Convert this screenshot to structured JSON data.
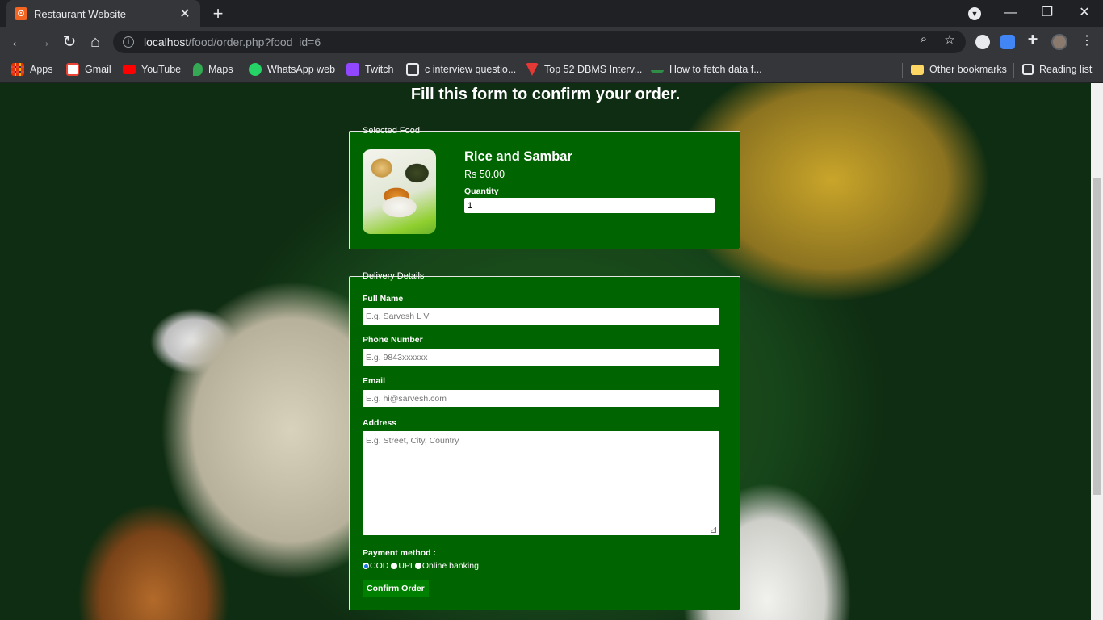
{
  "browser": {
    "tab_title": "Restaurant Website",
    "url_host": "localhost",
    "url_path": "/food/order.php?food_id=6",
    "bookmarks": [
      {
        "label": "Apps",
        "icon": "apps-grid-icon",
        "color": "#ea4335"
      },
      {
        "label": "Gmail",
        "icon": "gmail-icon",
        "color": "#ea4335"
      },
      {
        "label": "YouTube",
        "icon": "youtube-icon",
        "color": "#ff0000"
      },
      {
        "label": "Maps",
        "icon": "maps-icon",
        "color": "#34a853"
      },
      {
        "label": "WhatsApp web",
        "icon": "whatsapp-icon",
        "color": "#25d366"
      },
      {
        "label": "Twitch",
        "icon": "twitch-icon",
        "color": "#9146ff"
      },
      {
        "label": "c interview questio...",
        "icon": "page-icon",
        "color": "#e8eaed"
      },
      {
        "label": "Top 52 DBMS Interv...",
        "icon": "guru-icon",
        "color": "#e53935"
      },
      {
        "label": "How to fetch data f...",
        "icon": "geeks-icon",
        "color": "#2f8d46"
      }
    ],
    "other_bookmarks": "Other bookmarks",
    "reading_list": "Reading list"
  },
  "page": {
    "heading": "Fill this form to confirm your order.",
    "selected_food": {
      "legend": "Selected Food",
      "name": "Rice and Sambar",
      "price": "Rs 50.00",
      "quantity_label": "Quantity",
      "quantity_value": "1"
    },
    "delivery": {
      "legend": "Delivery Details",
      "full_name_label": "Full Name",
      "full_name_placeholder": "E.g. Sarvesh L V",
      "phone_label": "Phone Number",
      "phone_placeholder": "E.g. 9843xxxxxx",
      "email_label": "Email",
      "email_placeholder": "E.g. hi@sarvesh.com",
      "address_label": "Address",
      "address_placeholder": "E.g. Street, City, Country",
      "payment_label": "Payment method :",
      "payment_options": [
        "COD",
        "UPI",
        "Online banking"
      ],
      "payment_selected": "COD",
      "confirm_label": "Confirm Order"
    }
  },
  "colors": {
    "form_bg": "#006400",
    "button_bg": "#008000",
    "accent_radio": "#1a73e8"
  }
}
